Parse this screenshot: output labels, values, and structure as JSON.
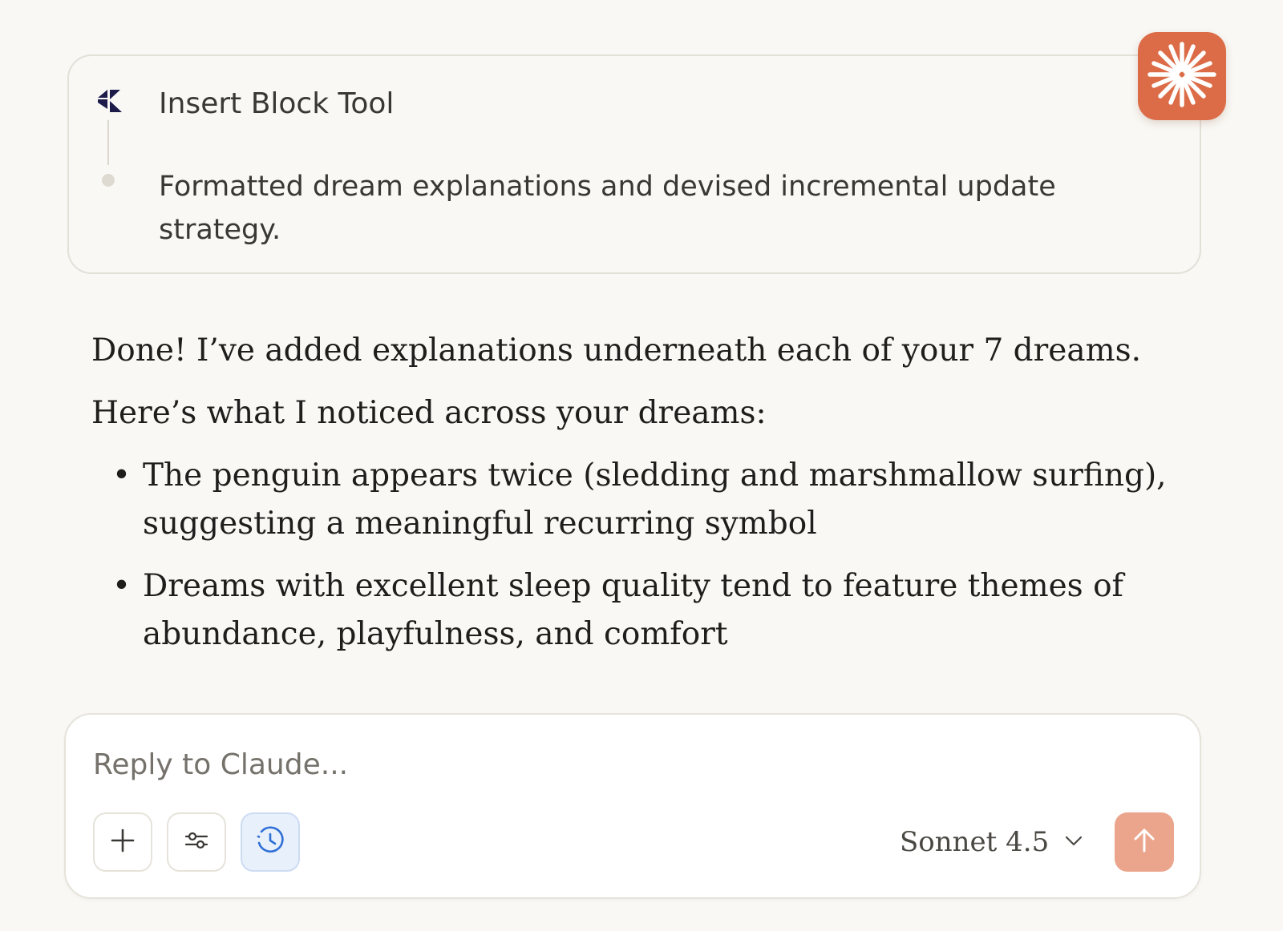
{
  "tool_card": {
    "logo_icon": "tool-logo-icon",
    "title": "Insert Block Tool",
    "summary": "Formatted dream explanations and devised incremental update strategy."
  },
  "badge": {
    "icon": "claude-spark-icon",
    "color": "#dc6c47"
  },
  "response": {
    "paragraphs": [
      "Done! I’ve added explanations underneath each of your 7 dreams.",
      "Here’s what I noticed across your dreams:"
    ],
    "bullets": [
      "The penguin appears twice (sledding and marshmallow surfing), suggesting a meaningful recurring symbol",
      "Dreams with excellent sleep quality tend to feature themes of abundance, playfulness, and comfort"
    ],
    "bullet_glyph": "•"
  },
  "composer": {
    "placeholder": "Reply to Claude...",
    "value": "",
    "buttons": {
      "add_icon": "plus-icon",
      "tools_icon": "sliders-icon",
      "history_icon": "clock-icon"
    },
    "model": "Sonnet 4.5",
    "model_dropdown_icon": "chevron-down-icon",
    "send_icon": "arrow-up-icon",
    "send_color": "#eba58d"
  }
}
